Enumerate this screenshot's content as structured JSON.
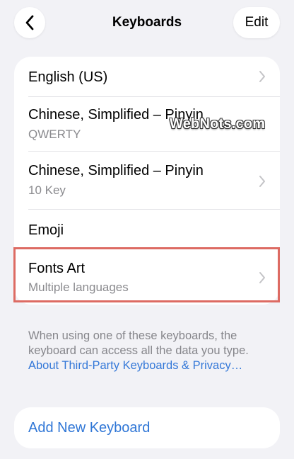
{
  "nav": {
    "title": "Keyboards",
    "edit_label": "Edit",
    "back_icon": "chevron-left-icon"
  },
  "keyboards": [
    {
      "title": "English (US)",
      "subtitle": "",
      "has_chevron": true
    },
    {
      "title": "Chinese, Simplified – Pinyin",
      "subtitle": "QWERTY",
      "has_chevron": false
    },
    {
      "title": "Chinese, Simplified – Pinyin",
      "subtitle": "10 Key",
      "has_chevron": true
    },
    {
      "title": "Emoji",
      "subtitle": "",
      "has_chevron": false
    },
    {
      "title": "Fonts Art",
      "subtitle": "Multiple languages",
      "has_chevron": true,
      "highlighted": true
    }
  ],
  "footer": {
    "note": "When using one of these keyboards, the keyboard can access all the data you type.",
    "link": "About Third-Party Keyboards & Privacy…"
  },
  "add_keyboard": {
    "label": "Add New Keyboard"
  },
  "watermark": "WebNots.com",
  "colors": {
    "background": "#f2f2f6",
    "card": "#ffffff",
    "accent": "#2f76d6",
    "secondary_text": "#8a8a8e",
    "highlight": "#dd6b63"
  }
}
